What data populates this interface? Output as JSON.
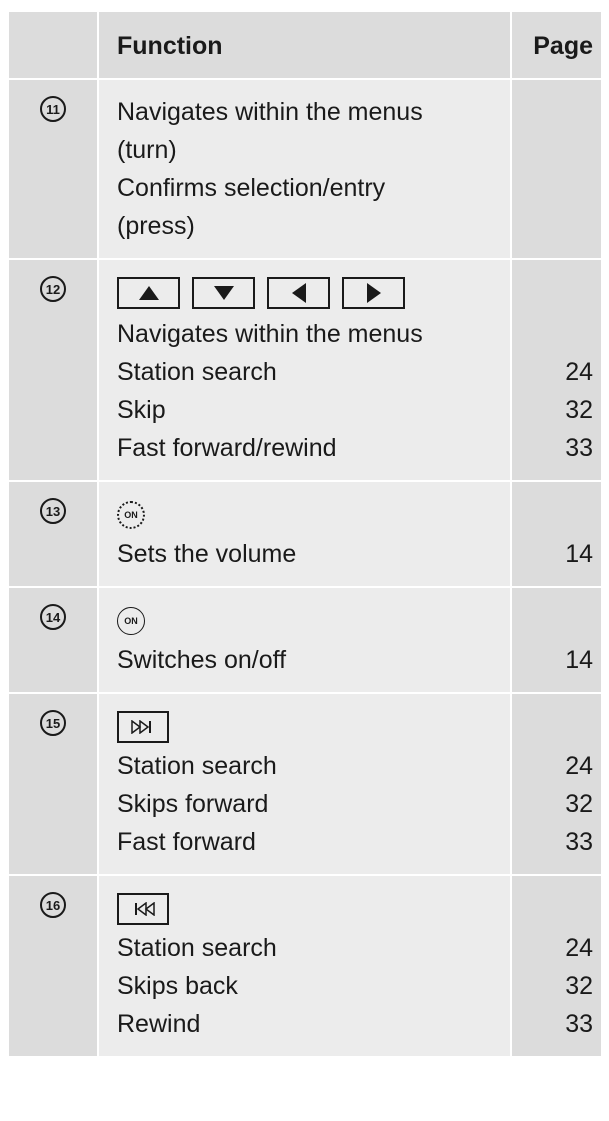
{
  "header": {
    "function_label": "Function",
    "page_label": "Page"
  },
  "rows": [
    {
      "number": "11",
      "lines": [
        "Navigates within the menus",
        "(turn)",
        "Confirms selection/entry",
        "(press)"
      ]
    },
    {
      "number": "12",
      "keys": [
        "up-arrow-icon",
        "down-arrow-icon",
        "left-arrow-icon",
        "right-arrow-icon"
      ],
      "lines": [
        "Navigates within the menus",
        "Station search",
        "Skip",
        "Fast forward/rewind"
      ],
      "pages": [
        "",
        "24",
        "32",
        "33"
      ]
    },
    {
      "number": "13",
      "knob_label": "ON",
      "lines": [
        "Sets the volume"
      ],
      "pages": [
        "14"
      ]
    },
    {
      "number": "14",
      "knob_label": "ON",
      "lines": [
        "Switches on/off"
      ],
      "pages": [
        "14"
      ]
    },
    {
      "number": "15",
      "key": "skip-forward-icon",
      "lines": [
        "Station search",
        "Skips forward",
        "Fast forward"
      ],
      "pages": [
        "24",
        "32",
        "33"
      ]
    },
    {
      "number": "16",
      "key": "skip-back-icon",
      "lines": [
        "Station search",
        "Skips back",
        "Rewind"
      ],
      "pages": [
        "24",
        "32",
        "33"
      ]
    }
  ]
}
